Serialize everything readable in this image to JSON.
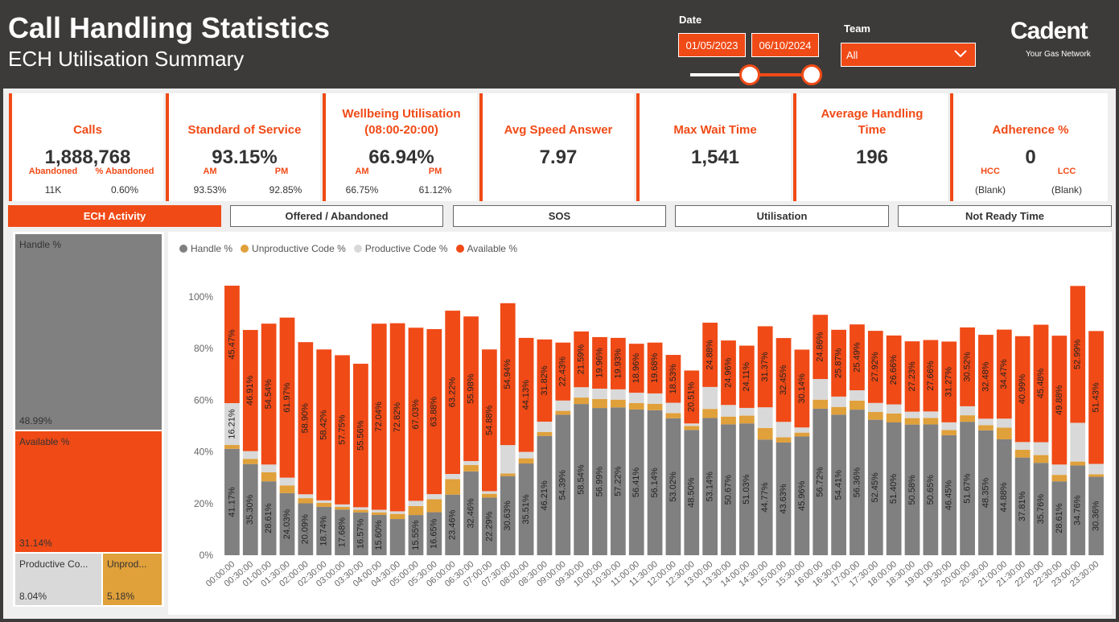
{
  "header": {
    "title": "Call Handling Statistics",
    "subtitle": "ECH Utilisation Summary",
    "date_label": "Date",
    "date_start": "01/05/2023",
    "date_end": "06/10/2024",
    "team_label": "Team",
    "team_value": "All",
    "logo": "Cadent",
    "logo_sub": "Your Gas Network"
  },
  "kpis": {
    "calls": {
      "title": "Calls",
      "value": "1,888,768",
      "sub1_label": "Abandoned",
      "sub1_value": "11K",
      "sub2_label": "% Abandoned",
      "sub2_value": "0.60%"
    },
    "sos": {
      "title": "Standard of Service",
      "value": "93.15%",
      "sub1_label": "AM",
      "sub1_value": "93.53%",
      "sub2_label": "PM",
      "sub2_value": "92.85%"
    },
    "wellbeing": {
      "title": "Wellbeing Utilisation (08:00-20:00)",
      "title_line1": "Wellbeing Utilisation",
      "title_line2": "(08:00-20:00)",
      "value": "66.94%",
      "sub1_label": "AM",
      "sub1_value": "66.75%",
      "sub2_label": "PM",
      "sub2_value": "61.12%"
    },
    "asa": {
      "title": "Avg Speed Answer",
      "value": "7.97"
    },
    "maxwait": {
      "title": "Max Wait Time",
      "value": "1,541"
    },
    "aht": {
      "title_line1": "Average Handling",
      "title_line2": "Time",
      "value": "196"
    },
    "adherence": {
      "title": "Adherence %",
      "value": "0",
      "sub1_label": "HCC",
      "sub1_value": "(Blank)",
      "sub2_label": "LCC",
      "sub2_value": "(Blank)"
    }
  },
  "tabs": [
    "ECH Activity",
    "Offered / Abandoned",
    "SOS",
    "Utilisation",
    "Not Ready Time"
  ],
  "treemap": {
    "handle": {
      "label": "Handle %",
      "value": "48.99%"
    },
    "available": {
      "label": "Available %",
      "value": "31.14%"
    },
    "productive": {
      "label": "Productive Co...",
      "value": "8.04%"
    },
    "unproductive": {
      "label": "Unprod...",
      "value": "5.18%"
    }
  },
  "colors": {
    "accent": "#f04a16",
    "handle": "#808080",
    "unproductive": "#e0a03a",
    "productive": "#d9d9d9",
    "available": "#f04a16",
    "header_bg": "#3d3b39"
  },
  "chart_data": {
    "type": "bar",
    "stacked": true,
    "legend": [
      "Handle %",
      "Unproductive Code %",
      "Productive Code %",
      "Available %"
    ],
    "legend_position": "top-left",
    "ylim": [
      0,
      105
    ],
    "yticks": [
      "0%",
      "20%",
      "40%",
      "60%",
      "80%",
      "100%"
    ],
    "categories": [
      "00:00:00",
      "00:30:00",
      "01:00:00",
      "01:30:00",
      "02:00:00",
      "02:30:00",
      "03:00:00",
      "03:30:00",
      "04:00:00",
      "04:30:00",
      "05:00:00",
      "05:30:00",
      "06:00:00",
      "06:30:00",
      "07:00:00",
      "07:30:00",
      "08:00:00",
      "08:30:00",
      "09:00:00",
      "09:30:00",
      "10:00:00",
      "10:30:00",
      "11:00:00",
      "11:30:00",
      "12:00:00",
      "12:30:00",
      "13:00:00",
      "13:30:00",
      "14:00:00",
      "14:30:00",
      "15:00:00",
      "15:30:00",
      "16:00:00",
      "16:30:00",
      "17:00:00",
      "17:30:00",
      "18:00:00",
      "18:30:00",
      "19:00:00",
      "19:30:00",
      "20:00:00",
      "20:30:00",
      "21:00:00",
      "21:30:00",
      "22:00:00",
      "22:30:00",
      "23:00:00",
      "23:30:00"
    ],
    "series": [
      {
        "name": "Handle %",
        "values": [
          41.17,
          35.3,
          28.61,
          24.03,
          20.09,
          18.74,
          17.68,
          16.57,
          15.6,
          14.0,
          15.55,
          16.65,
          23.46,
          32.46,
          22.29,
          30.63,
          35.51,
          46.21,
          54.39,
          58.54,
          56.99,
          57.22,
          56.41,
          56.14,
          53.02,
          48.5,
          53.14,
          50.67,
          51.03,
          44.77,
          43.63,
          45.96,
          56.72,
          54.41,
          56.36,
          52.45,
          51.4,
          50.58,
          50.65,
          46.45,
          51.67,
          48.35,
          44.88,
          37.81,
          35.76,
          28.61,
          34.76,
          30.36
        ]
      },
      {
        "name": "Unproductive Code %",
        "values": [
          1.5,
          2.0,
          3.5,
          3.0,
          2.0,
          1.5,
          1.0,
          1.0,
          1.0,
          2.0,
          3.5,
          5.0,
          6.0,
          2.5,
          1.5,
          1.0,
          2.0,
          1.5,
          1.5,
          2.5,
          3.5,
          3.0,
          2.5,
          2.5,
          2.0,
          1.5,
          3.5,
          3.0,
          3.0,
          4.5,
          2.0,
          1.5,
          3.5,
          3.0,
          3.5,
          3.0,
          3.5,
          2.5,
          2.5,
          2.0,
          2.5,
          2.0,
          4.5,
          3.0,
          3.0,
          2.5,
          1.5,
          1.0
        ]
      },
      {
        "name": "Productive Code %",
        "values": [
          16.21,
          3.0,
          3.0,
          3.0,
          1.5,
          1.0,
          1.0,
          1.0,
          1.0,
          1.0,
          2.0,
          2.0,
          2.0,
          1.5,
          1.0,
          11.0,
          2.5,
          4.0,
          4.0,
          4.0,
          4.0,
          4.0,
          4.0,
          4.0,
          4.0,
          1.0,
          8.5,
          4.5,
          3.0,
          8.0,
          6.0,
          2.0,
          8.0,
          4.0,
          4.0,
          3.5,
          3.5,
          2.5,
          2.5,
          3.0,
          3.5,
          2.5,
          3.5,
          3.0,
          5.0,
          4.0,
          15.0,
          4.0
        ]
      },
      {
        "name": "Available %",
        "values": [
          45.47,
          46.91,
          54.54,
          61.97,
          58.9,
          58.42,
          57.75,
          55.56,
          72.04,
          72.82,
          67.03,
          63.88,
          63.22,
          55.98,
          54.88,
          54.94,
          44.13,
          31.82,
          22.43,
          21.59,
          19.96,
          19.93,
          18.96,
          19.68,
          18.53,
          20.51,
          24.88,
          24.96,
          24.11,
          31.37,
          32.45,
          30.14,
          24.86,
          25.87,
          25.49,
          27.92,
          26.66,
          27.23,
          27.66,
          31.27,
          30.52,
          32.48,
          34.47,
          40.99,
          45.48,
          49.88,
          52.99,
          51.43
        ]
      }
    ],
    "labels_handle": [
      "41.17%",
      "35.30%",
      "28.61%",
      "24.03%",
      "20.09%",
      "18.74%",
      "17.68%",
      "16.57%",
      "15.60%",
      "",
      "15.55%",
      "16.65%",
      "23.46%",
      "32.46%",
      "22.29%",
      "30.63%",
      "35.51%",
      "46.21%",
      "54.39%",
      "58.54%",
      "56.99%",
      "57.22%",
      "56.41%",
      "56.14%",
      "53.02%",
      "48.50%",
      "53.14%",
      "50.67%",
      "51.03%",
      "44.77%",
      "43.63%",
      "45.96%",
      "56.72%",
      "54.41%",
      "56.36%",
      "52.45%",
      "51.40%",
      "50.58%",
      "50.65%",
      "46.45%",
      "51.67%",
      "48.35%",
      "44.88%",
      "37.81%",
      "35.76%",
      "28.61%",
      "34.76%",
      "30.36%"
    ],
    "labels_available": [
      "45.47%",
      "46.91%",
      "54.54%",
      "61.97%",
      "58.90%",
      "58.42%",
      "57.75%",
      "55.56%",
      "72.04%",
      "72.82%",
      "67.03%",
      "63.88%",
      "63.22%",
      "55.98%",
      "54.88%",
      "54.94%",
      "44.13%",
      "31.82%",
      "22.43%",
      "21.59%",
      "19.96%",
      "19.93%",
      "18.96%",
      "19.68%",
      "18.53%",
      "20.51%",
      "24.88%",
      "24.96%",
      "24.11%",
      "31.37%",
      "32.45%",
      "30.14%",
      "24.86%",
      "25.87%",
      "25.49%",
      "27.92%",
      "26.66%",
      "27.23%",
      "27.66%",
      "31.27%",
      "30.52%",
      "32.48%",
      "34.47%",
      "40.99%",
      "45.48%",
      "49.88%",
      "52.99%",
      "51.43%"
    ],
    "labels_productive": [
      "16.21%",
      "",
      "",
      "",
      "",
      "",
      "",
      "",
      "",
      "",
      "",
      "",
      "",
      "",
      "",
      "",
      "",
      "",
      "",
      "",
      "",
      "",
      "",
      "",
      "",
      "",
      "",
      "",
      "",
      "",
      "",
      "",
      "",
      "",
      "",
      "",
      "",
      "",
      "",
      "",
      "",
      "",
      "",
      "",
      "",
      "",
      "",
      ""
    ]
  }
}
